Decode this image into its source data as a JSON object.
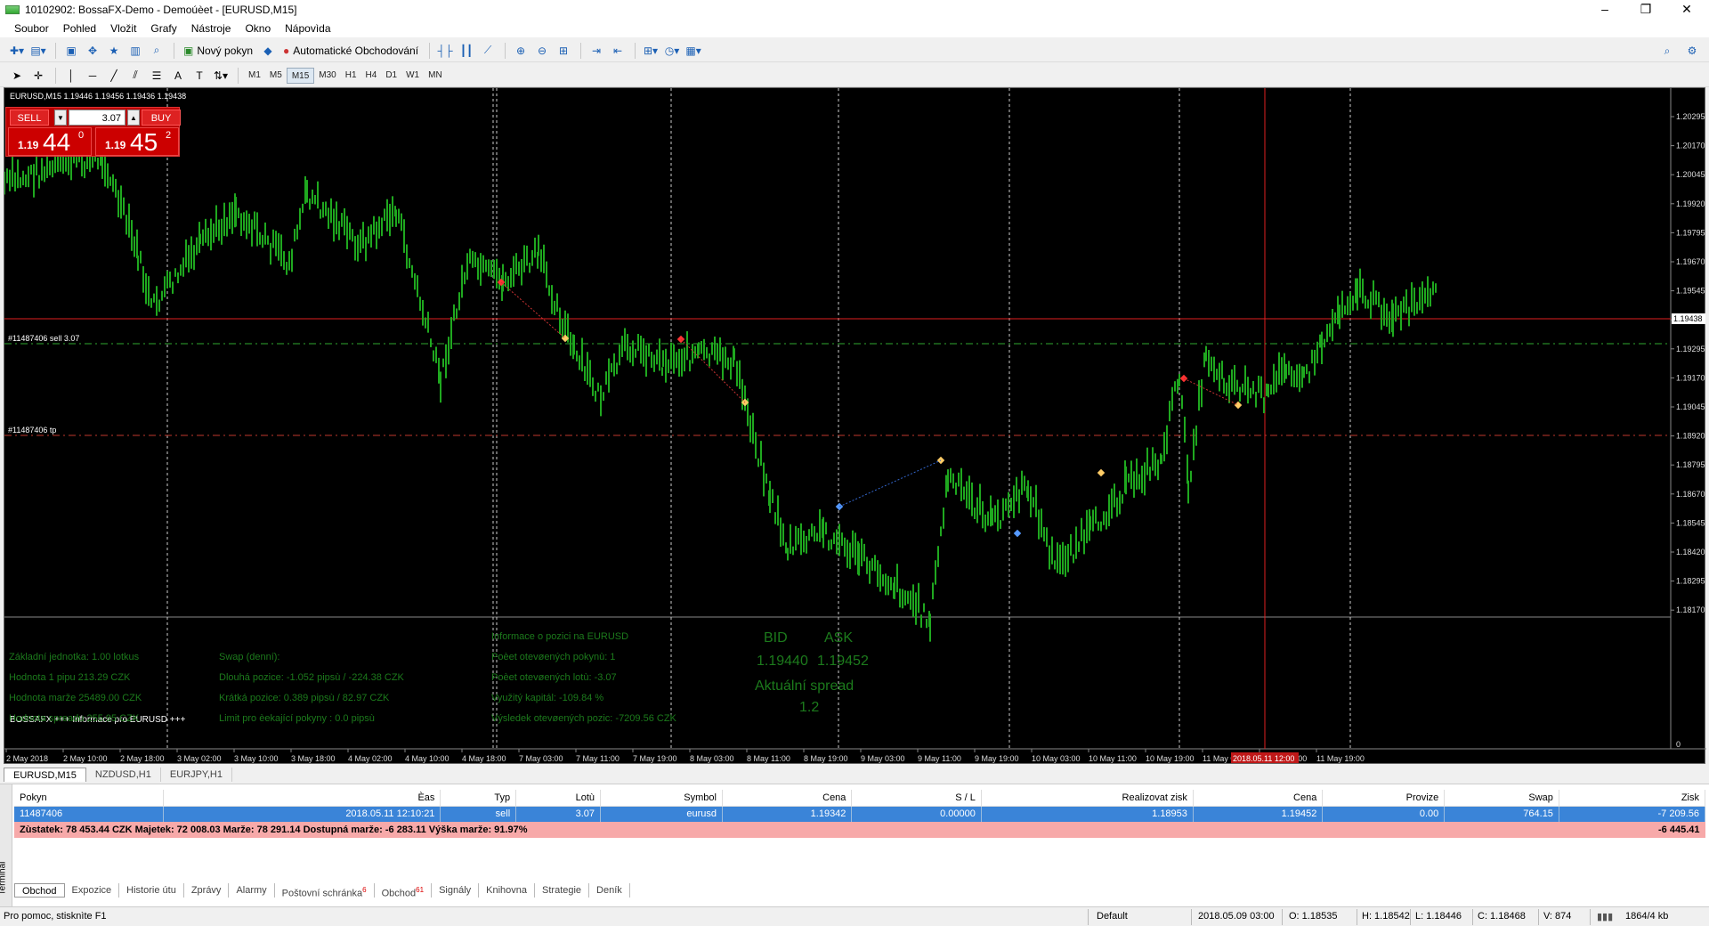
{
  "window": {
    "title": "10102902: BossaFX-Demo - Demoúèet - [EURUSD,M15]"
  },
  "menu": [
    "Soubor",
    "Pohled",
    "Vložit",
    "Grafy",
    "Nástroje",
    "Okno",
    "Nápovìda"
  ],
  "toolbar": {
    "new_order": "Nový pokyn",
    "auto_trading": "Automatické Obchodování"
  },
  "timeframes": [
    "M1",
    "M5",
    "M15",
    "M30",
    "H1",
    "H4",
    "D1",
    "W1",
    "MN"
  ],
  "active_timeframe": "M15",
  "chart": {
    "header": "EURUSD,M15  1.19446 1.19456 1.19436 1.19438",
    "trade_panel": {
      "sell": "SELL",
      "buy": "BUY",
      "lot": "3.07",
      "bid_prefix": "1.19",
      "bid_big": "44",
      "bid_sup": "0",
      "ask_prefix": "1.19",
      "ask_big": "45",
      "ask_sup": "2"
    },
    "order_line_label": "#11487406 sell 3.07",
    "tp_line_label": "#11487406 tp",
    "current_price_label": "1.19438",
    "y_ticks": [
      "1.20295",
      "1.20170",
      "1.20045",
      "1.19920",
      "1.19795",
      "1.19670",
      "1.19545",
      "1.19420",
      "1.19295",
      "1.19170",
      "1.19045",
      "1.18920",
      "1.18795",
      "1.18670",
      "1.18545",
      "1.18420",
      "1.18295",
      "1.18170"
    ],
    "indicator_zero": "0",
    "x_ticks": [
      "2 May 2018",
      "2 May 10:00",
      "2 May 18:00",
      "3 May 02:00",
      "3 May 10:00",
      "3 May 18:00",
      "4 May 02:00",
      "4 May 10:00",
      "4 May 18:00",
      "7 May 03:00",
      "7 May 11:00",
      "7 May 19:00",
      "8 May 03:00",
      "8 May 11:00",
      "8 May 19:00",
      "9 May 03:00",
      "9 May 11:00",
      "9 May 19:00",
      "10 May 03:00",
      "10 May 11:00",
      "10 May 19:00",
      "11 May 03:00",
      "11 May 11:00",
      "11 May 19:00"
    ],
    "crosshair_time_label": "2018.05.11 12:00",
    "info": {
      "heading": "BOSSAFX +++ Informace pro EURUSD +++",
      "col1": [
        "Základní jednotka: 1.00  lotkus",
        "Hodnota 1 pipu 213.29 CZK",
        "Hodnota marže 25489.00 CZK",
        "Hodnota spreadu 255.95 CZK"
      ],
      "col2": [
        "Swap (denní):",
        "Dlouhá pozice:  -1.052 pipsù / -224.38 CZK",
        "Krátká pozice:  0.389 pipsù /  82.97 CZK",
        "Limit pro èekající pokyny : 0.0  pipsù"
      ],
      "col3": [
        "Informace o pozici na EURUSD",
        "Poèet otevøených pokynù: 1",
        "Poèet otevøených lotù: -3.07",
        "Využitý kapitál: -109.84 %",
        "Výsledek otevøených pozic: -7209.56 CZK"
      ],
      "bid_label": "BID",
      "ask_label": "ASK",
      "bid": "1.19440",
      "ask": "1.19452",
      "spread_label": "Aktuální spread",
      "spread": "1.2"
    }
  },
  "chart_tabs": [
    "EURUSD,M15",
    "NZDUSD,H1",
    "EURJPY,H1"
  ],
  "terminal": {
    "side_label": "Terminál",
    "columns": [
      "Pokyn",
      "Èas",
      "Typ",
      "Lotù",
      "Symbol",
      "Cena",
      "S / L",
      "Realizovat zisk",
      "Cena",
      "Provize",
      "Swap",
      "Zisk"
    ],
    "row": [
      "11487406",
      "2018.05.11 12:10:21",
      "sell",
      "3.07",
      "eurusd",
      "1.19342",
      "0.00000",
      "1.18953",
      "1.19452",
      "0.00",
      "764.15",
      "-7 209.56"
    ],
    "balance_text": "Zùstatek: 78 453.44 CZK  Majetek: 72 008.03  Marže: 78 291.14  Dostupná marže: -6 283.11  Výška marže: 91.97%",
    "balance_profit": "-6 445.41",
    "tabs": [
      {
        "label": "Obchod",
        "badge": ""
      },
      {
        "label": "Expozice",
        "badge": ""
      },
      {
        "label": "Historie útu",
        "badge": ""
      },
      {
        "label": "Zprávy",
        "badge": ""
      },
      {
        "label": "Alarmy",
        "badge": ""
      },
      {
        "label": "Poštovní schránka",
        "badge": "6"
      },
      {
        "label": "Obchod",
        "badge": "61"
      },
      {
        "label": "Signály",
        "badge": ""
      },
      {
        "label": "Knihovna",
        "badge": ""
      },
      {
        "label": "Strategie",
        "badge": ""
      },
      {
        "label": "Deník",
        "badge": ""
      }
    ]
  },
  "status": {
    "help": "Pro pomoc, stisknìte F1",
    "profile": "Default",
    "time": "2018.05.09 03:00",
    "open": "O: 1.18535",
    "high": "H: 1.18542",
    "low": "L: 1.18446",
    "close": "C: 1.18468",
    "volume": "V: 874",
    "traffic": "1864/4 kb"
  },
  "colors": {
    "candle": "#1fa81f",
    "info_text": "#1c7a1c",
    "order_line": "#2fa82f",
    "tp_line": "#c0392b",
    "price_line": "#e02020",
    "selected_row": "#3a84d8",
    "balance_row": "#f7a9a9"
  }
}
